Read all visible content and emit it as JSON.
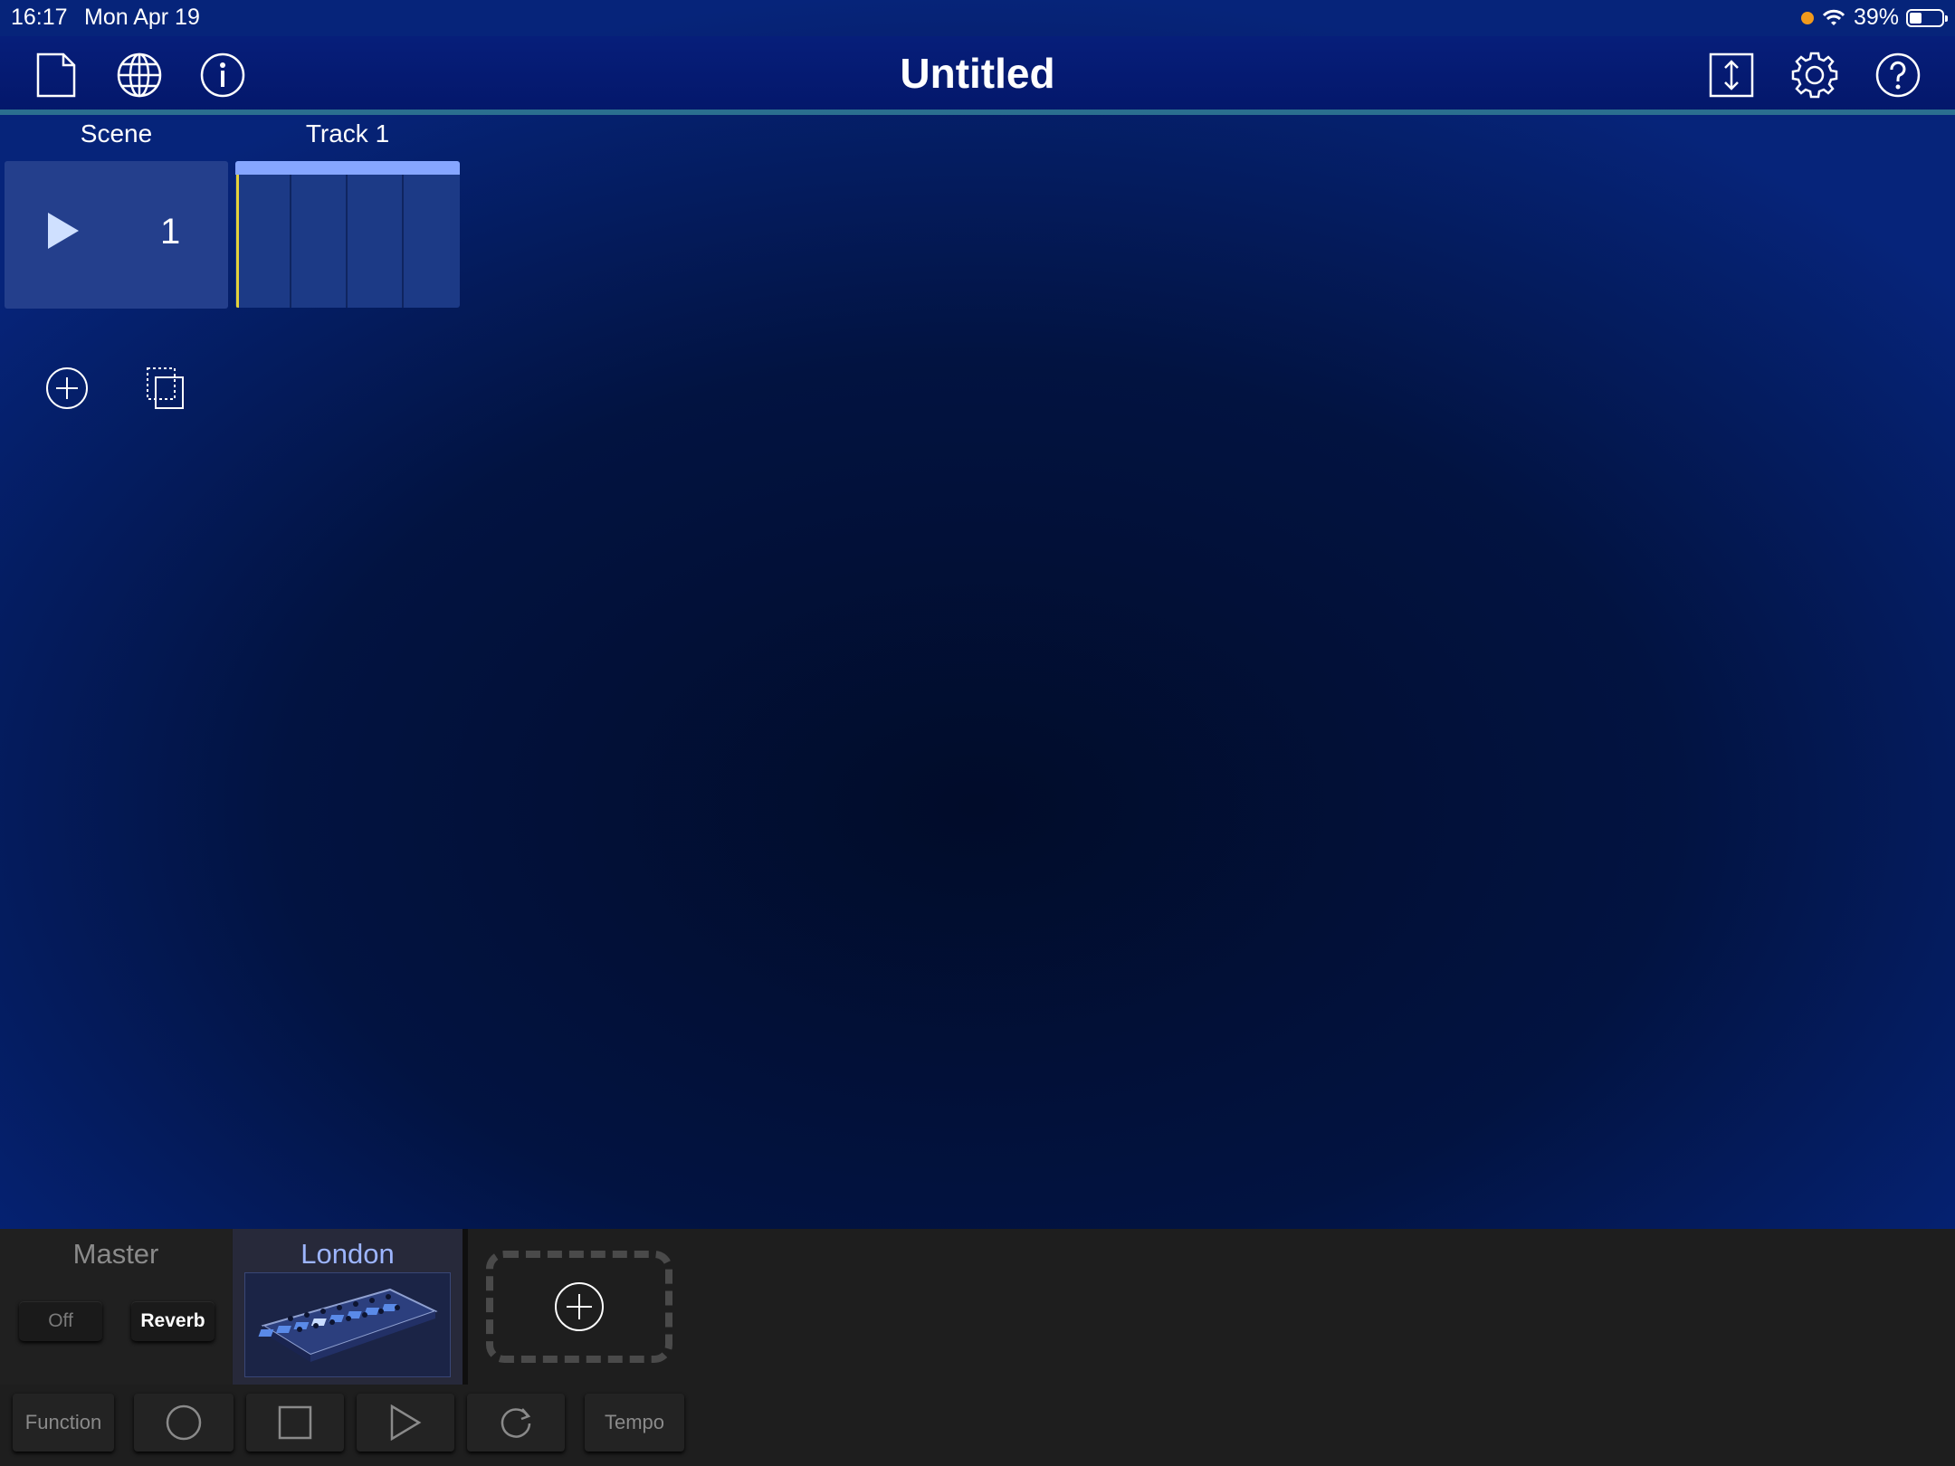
{
  "status_bar": {
    "time": "16:17",
    "date": "Mon Apr 19",
    "battery": "39%"
  },
  "toolbar": {
    "title": "Untitled"
  },
  "grid": {
    "scene_header": "Scene",
    "track_header": "Track 1",
    "scene_number": "1"
  },
  "master": {
    "label": "Master",
    "off_label": "Off",
    "reverb_label": "Reverb"
  },
  "instrument": {
    "name": "London"
  },
  "transport": {
    "function_label": "Function",
    "tempo_label": "Tempo"
  }
}
